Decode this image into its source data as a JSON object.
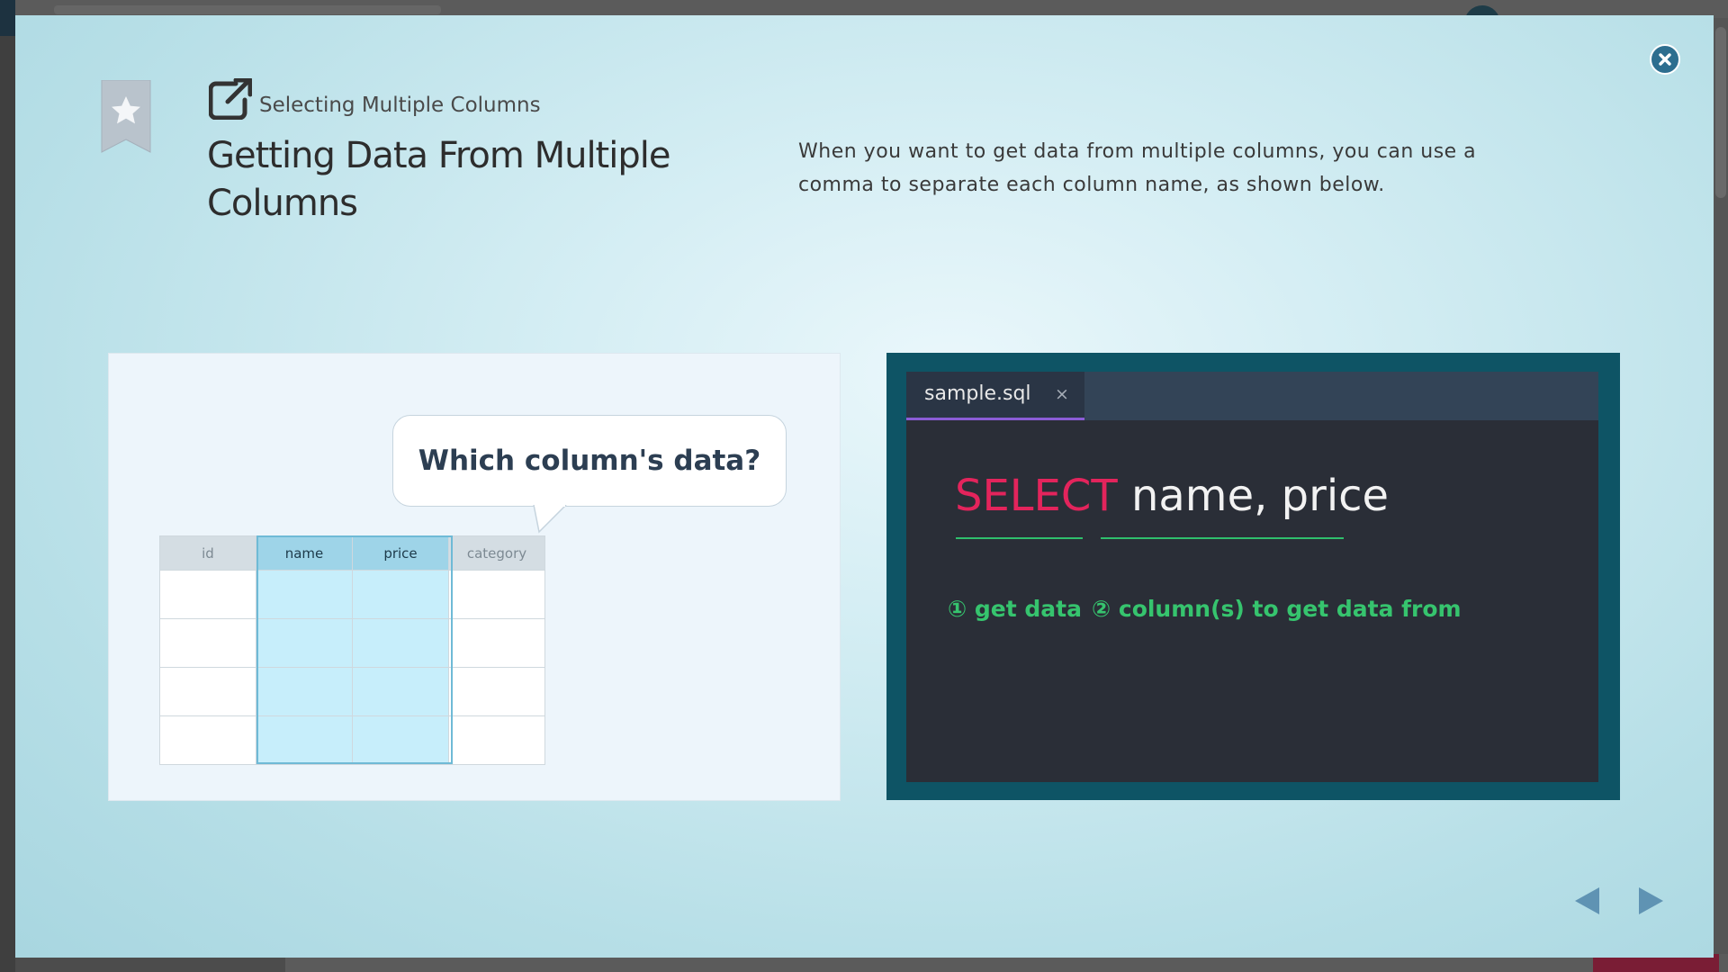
{
  "modal": {
    "subtitle": "Selecting Multiple Columns",
    "title": "Getting Data From Multiple Columns",
    "description": "When you want to get data from multiple columns, you can use a comma to separate each column name, as shown below."
  },
  "illustration": {
    "bubble_text": "Which column's data?",
    "table": {
      "headers": [
        "id",
        "name",
        "price",
        "category"
      ],
      "highlighted_columns": [
        "name",
        "price"
      ],
      "row_count": 4
    }
  },
  "code_editor": {
    "tab_label": "sample.sql",
    "tab_close": "×",
    "keyword": "SELECT",
    "columns": "name, price",
    "annotation_1": "① get data",
    "annotation_2": "② column(s) to get data from"
  },
  "icons": {
    "close": "close-icon",
    "bookmark": "bookmark-star-icon",
    "external_link": "external-link-icon",
    "prev": "triangle-left-icon",
    "next": "triangle-right-icon"
  },
  "colors": {
    "keyword": "#e3245c",
    "annotation": "#36c46e",
    "highlight": "#c7eefb",
    "tab_underline": "#8b5cd6",
    "code_frame": "#0e5465"
  }
}
